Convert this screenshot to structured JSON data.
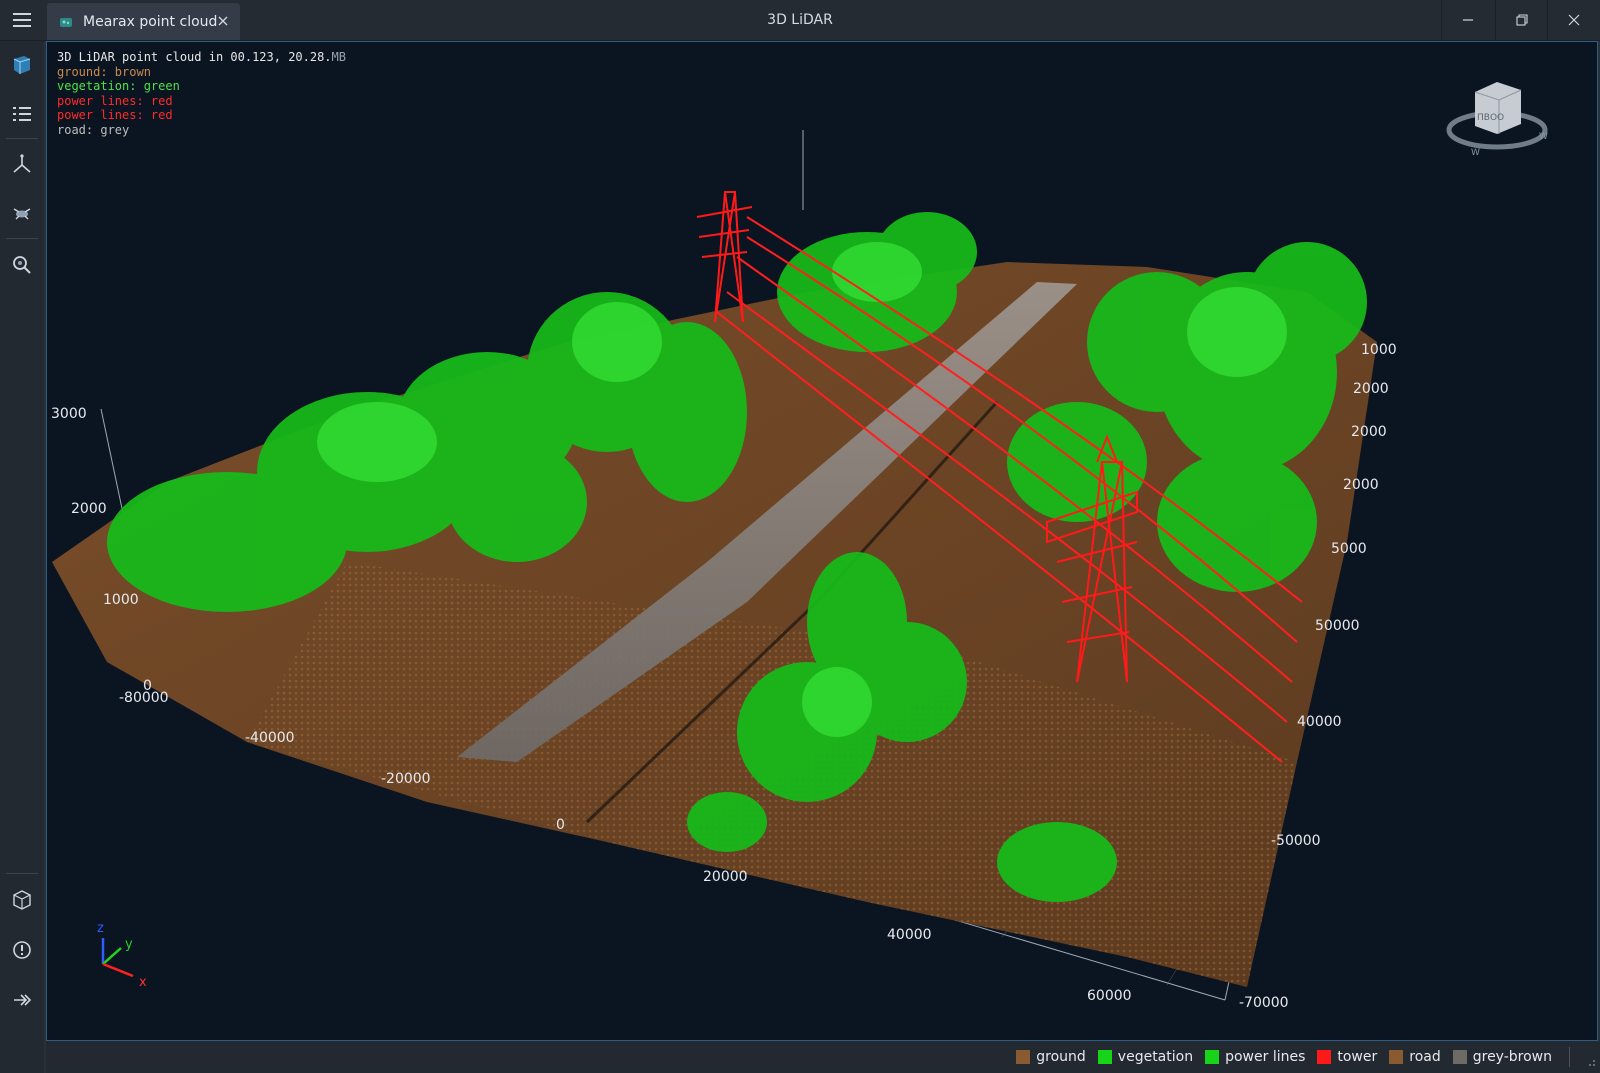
{
  "window": {
    "title": "3D LiDAR",
    "tab_label": "Mearax point cloud"
  },
  "icons": {
    "menu": "hamburger-menu-icon",
    "tab": "point-cloud-icon",
    "close_tab": "close-icon",
    "minimize": "minimize-icon",
    "maximize": "restore-icon",
    "close": "close-icon",
    "sidebar": [
      "layers-icon",
      "list-icon",
      "axes-icon",
      "drone-icon",
      "search-icon",
      "cube-stack-icon",
      "info-icon",
      "export-icon"
    ],
    "view_cube": "view-cube-icon",
    "axis_triad": "xyz-axis-icon"
  },
  "info": {
    "header": "3D LiDAR point cloud in 00.123, 20.28.",
    "size_unit": "MB",
    "lines": {
      "ground": "ground: brown",
      "vegetation": "vegetation: green",
      "power1": "power lines: red",
      "power2": "power lines: red",
      "road": "road: grey"
    }
  },
  "view_cube": {
    "face_label": "ПВОО",
    "compass": [
      "W",
      "W"
    ]
  },
  "axis_triad": {
    "x": "x",
    "y": "y",
    "z": "z"
  },
  "colors": {
    "ground": "#8a5a30",
    "vegetation": "#19c21a",
    "power_lines": "#ff1a1a",
    "road": "#9a8f88",
    "background": "#0b1522",
    "accent": "#2d5f86"
  },
  "axes": {
    "z_ticks": [
      "0",
      "1000",
      "2000",
      "3000"
    ],
    "x_ticks": [
      "-80000",
      "-40000",
      "-20000",
      "0",
      "20000",
      "40000",
      "60000"
    ],
    "y_ticks": [
      "1000",
      "2000",
      "2000",
      "2000",
      "5000",
      "50000",
      "40000",
      "-50000",
      "-70000"
    ]
  },
  "legend": [
    {
      "label": "ground",
      "color": "#8a5a30"
    },
    {
      "label": "vegetation",
      "color": "#18d418"
    },
    {
      "label": "power lines",
      "color": "#18d418"
    },
    {
      "label": "tower",
      "color": "#ff1a1a"
    },
    {
      "label": "road",
      "color": "#8a5a30"
    },
    {
      "label": "grey-brown",
      "color": "#6e6a66"
    }
  ]
}
